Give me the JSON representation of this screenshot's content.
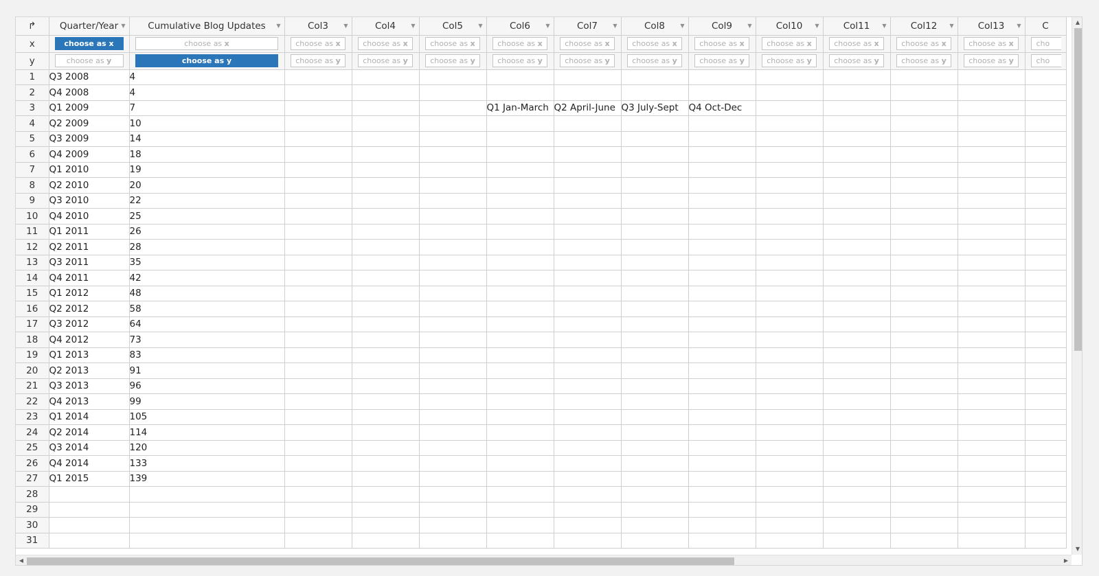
{
  "sheet": {
    "corner_icon": "corner-arrow-icon",
    "columns": [
      "Quarter/Year",
      "Cumulative Blog Updates",
      "Col3",
      "Col4",
      "Col5",
      "Col6",
      "Col7",
      "Col8",
      "Col9",
      "Col10",
      "Col11",
      "Col12",
      "Col13",
      "C"
    ],
    "selector_row_labels": {
      "x": "x",
      "y": "y"
    },
    "choose_x_prefix": "choose as ",
    "choose_x_suffix": "x",
    "choose_y_prefix": "choose as ",
    "choose_y_suffix": "y",
    "partial_col_x": "cho",
    "partial_col_y": "cho",
    "selected_x_column": 0,
    "selected_y_column": 1,
    "accent_color": "#2a76b9",
    "row_numbers": [
      "1",
      "2",
      "3",
      "4",
      "5",
      "6",
      "7",
      "8",
      "9",
      "10",
      "11",
      "12",
      "13",
      "14",
      "15",
      "16",
      "17",
      "18",
      "19",
      "20",
      "21",
      "22",
      "23",
      "24",
      "25",
      "26",
      "27",
      "28",
      "29",
      "30",
      "31"
    ],
    "rows": [
      [
        "Q3 2008",
        "4"
      ],
      [
        "Q4 2008",
        "4"
      ],
      [
        "Q1 2009",
        "7"
      ],
      [
        "Q2 2009",
        "10"
      ],
      [
        "Q3 2009",
        "14"
      ],
      [
        "Q4 2009",
        "18"
      ],
      [
        "Q1 2010",
        "19"
      ],
      [
        "Q2 2010",
        "20"
      ],
      [
        "Q3 2010",
        "22"
      ],
      [
        "Q4 2010",
        "25"
      ],
      [
        "Q1 2011",
        "26"
      ],
      [
        "Q2 2011",
        "28"
      ],
      [
        "Q3 2011",
        "35"
      ],
      [
        "Q4 2011",
        "42"
      ],
      [
        "Q1 2012",
        "48"
      ],
      [
        "Q2 2012",
        "58"
      ],
      [
        "Q3 2012",
        "64"
      ],
      [
        "Q4 2012",
        "73"
      ],
      [
        "Q1 2013",
        "83"
      ],
      [
        "Q2 2013",
        "91"
      ],
      [
        "Q3 2013",
        "96"
      ],
      [
        "Q4 2013",
        "99"
      ],
      [
        "Q1 2014",
        "105"
      ],
      [
        "Q2 2014",
        "114"
      ],
      [
        "Q3 2014",
        "120"
      ],
      [
        "Q4 2014",
        "133"
      ],
      [
        "Q1 2015",
        "139"
      ]
    ],
    "extra_cells": [
      {
        "row": 2,
        "col": 5,
        "text": "Q1 Jan-March"
      },
      {
        "row": 2,
        "col": 6,
        "text": "Q2 April-June"
      },
      {
        "row": 2,
        "col": 7,
        "text": "Q3 July-Sept"
      },
      {
        "row": 2,
        "col": 8,
        "text": "Q4 Oct-Dec"
      }
    ]
  },
  "scrollbars": {
    "vertical": {
      "position": 0.0
    },
    "horizontal": {
      "position": 0.0
    }
  }
}
